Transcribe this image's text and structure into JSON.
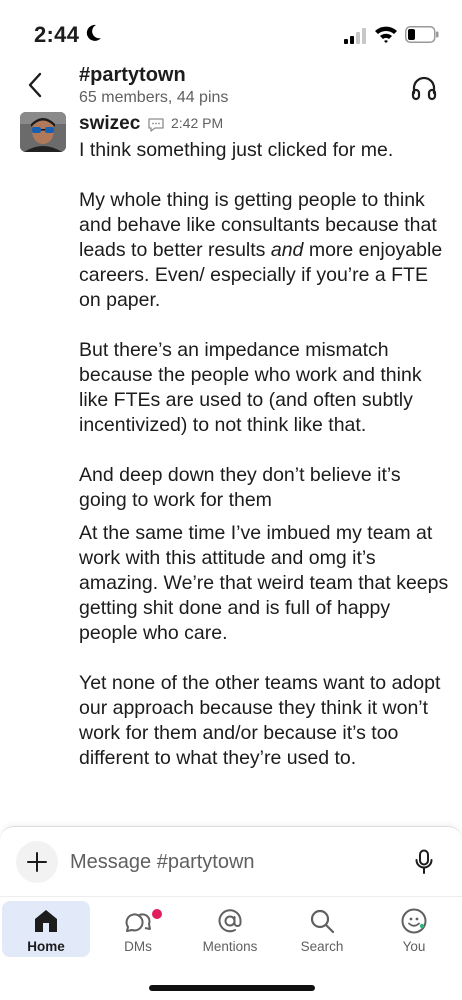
{
  "status_bar": {
    "time": "2:44"
  },
  "header": {
    "channel_name": "#partytown",
    "channel_meta": "65 members, 44 pins"
  },
  "message": {
    "sender": "swizec",
    "time": "2:42 PM",
    "paragraphs": [
      "I think something just clicked for me.",
      "My whole thing is getting people to think and behave like consultants because that leads to better results",
      "and",
      "more enjoyable careers. Even/ especially if you’re a FTE on paper.",
      "But there’s an impedance mismatch because the people who work and think like FTEs are used to (and often subtly incentivized) to not think like that.",
      "And deep down they don’t believe it’s going to work for them",
      "At the same time I’ve imbued my team at work with this attitude and omg it’s amazing. We’re that weird team that keeps getting shit done and is full of happy people who care.",
      "Yet none of the other teams want to adopt our approach because they think it won’t work for them and/or because it’s too different to what they’re used to."
    ]
  },
  "composer": {
    "placeholder": "Message #partytown"
  },
  "tabs": [
    {
      "label": "Home",
      "icon": "home-icon",
      "active": true
    },
    {
      "label": "DMs",
      "icon": "dms-icon",
      "badge": true
    },
    {
      "label": "Mentions",
      "icon": "at-sign-icon"
    },
    {
      "label": "Search",
      "icon": "search-icon"
    },
    {
      "label": "You",
      "icon": "profile-icon"
    }
  ],
  "colors": {
    "active_tab_bg": "#e2e9f8",
    "badge": "#e01e5a",
    "secondary_text": "#616061"
  }
}
